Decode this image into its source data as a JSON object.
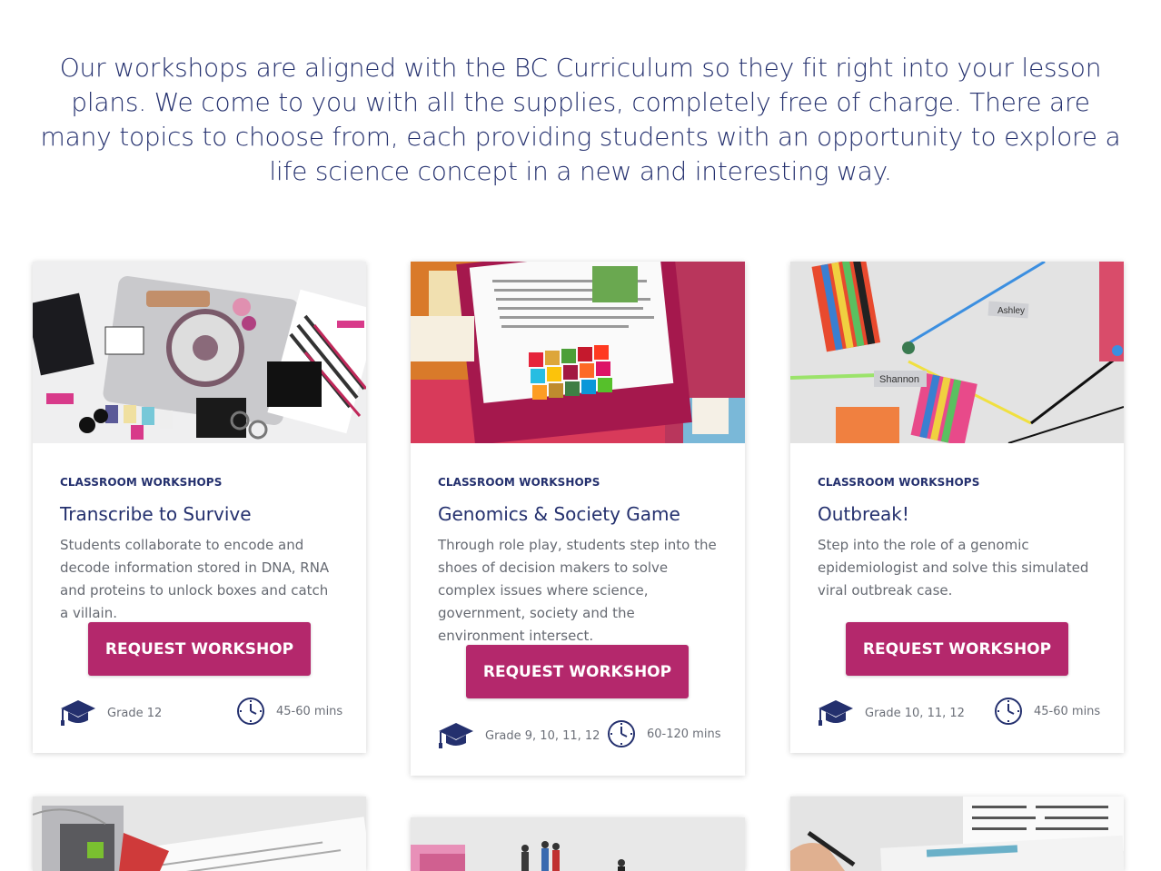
{
  "intro": "Our workshops are aligned with the BC Curriculum so they fit right into your lesson plans. We come to you with all the supplies, completely free of charge. There are many topics to choose from, each providing students with an opportunity to explore a life science concept in a new and interesting way.",
  "colors": {
    "accent": "#b4286c",
    "heading": "#24306e",
    "body_text": "#666a72"
  },
  "cards": [
    {
      "category": "CLASSROOM WORKSHOPS",
      "title": "Transcribe to Survive",
      "description": "Students collaborate to encode and decode information stored in DNA, RNA and proteins to unlock boxes and catch a villain.",
      "button": "REQUEST WORKSHOP",
      "grade": "Grade 12",
      "duration": "45-60 mins",
      "grade_icon": "graduation-cap-icon",
      "time_icon": "clock-icon"
    },
    {
      "category": "CLASSROOM WORKSHOPS",
      "title": "Genomics & Society Game",
      "description": "Through role play, students step into the shoes of decision makers to solve complex issues where science, government, society and the environment intersect.",
      "button": "REQUEST WORKSHOP",
      "grade": "Grade 9, 10, 11, 12",
      "duration": "60-120 mins",
      "grade_icon": "graduation-cap-icon",
      "time_icon": "clock-icon"
    },
    {
      "category": "CLASSROOM WORKSHOPS",
      "title": "Outbreak!",
      "description": "Step into the role of a genomic epidemiologist and solve this simulated viral outbreak case.",
      "button": "REQUEST WORKSHOP",
      "grade": "Grade 10, 11, 12",
      "duration": "45-60 mins",
      "grade_icon": "graduation-cap-icon",
      "time_icon": "clock-icon"
    }
  ],
  "image_labels": {
    "ashley": "Ashley",
    "shannon": "Shannon"
  }
}
